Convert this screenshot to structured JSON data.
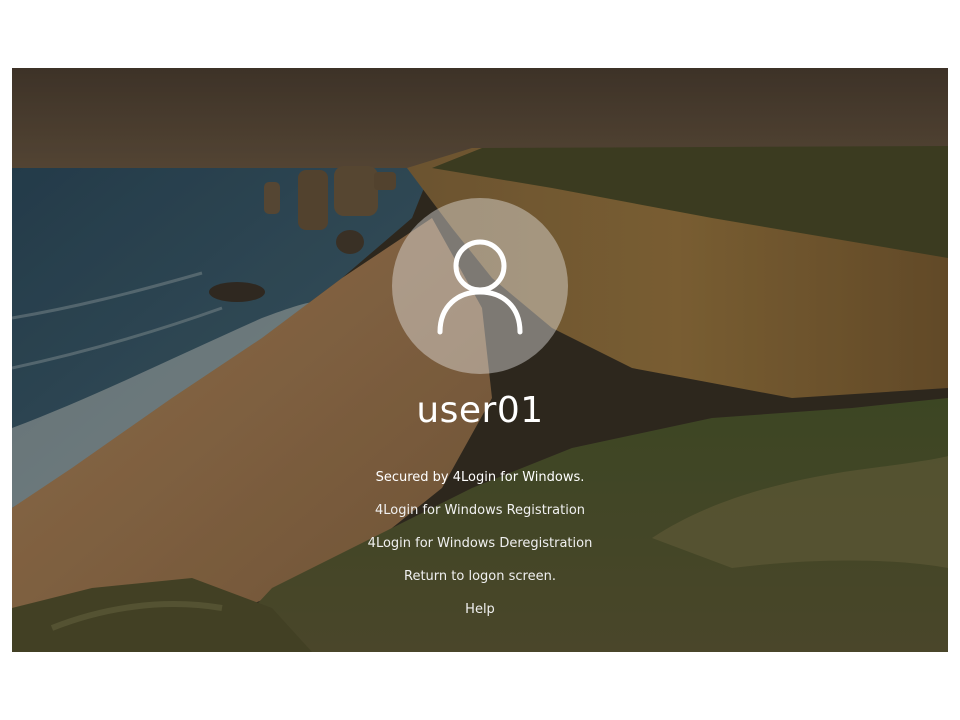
{
  "login": {
    "username": "user01",
    "avatar_icon": "user-silhouette-icon",
    "secured_text": "Secured by 4Login for Windows.",
    "links": [
      {
        "label": "4Login for Windows Registration"
      },
      {
        "label": "4Login for Windows Deregistration"
      },
      {
        "label": "Return to logon screen."
      },
      {
        "label": "Help"
      }
    ]
  },
  "colors": {
    "text": "#ffffff",
    "avatar_fill": "#ebebeb"
  }
}
